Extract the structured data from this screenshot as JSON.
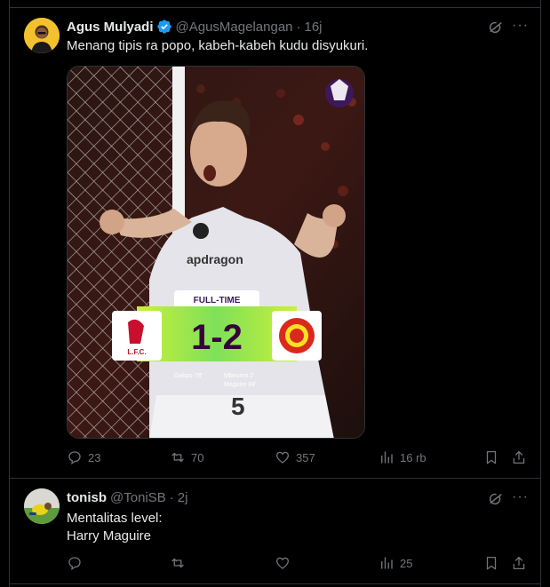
{
  "tweet1": {
    "name": "Agus Mulyadi",
    "handle": "@AgusMagelangan",
    "separator": "·",
    "time": "16j",
    "text": "Menang tipis ra popo, kabeh-kabeh kudu disyukuri.",
    "media": {
      "label": "FULL-TIME",
      "score": "1-2",
      "home_scorers": "Gakpo 78'",
      "away_scorers_1": "Mbeumo 2'",
      "away_scorers_2": "Maguire 84'",
      "shirt_sponsor": "apdragon",
      "shirt_number": "5",
      "home_crest_text": "L.F.C."
    },
    "counts": {
      "replies": "23",
      "reposts": "70",
      "likes": "357",
      "views": "16 rb"
    }
  },
  "tweet2": {
    "name": "tonisb",
    "handle": "@ToniSB",
    "separator": "·",
    "time": "2j",
    "text_line1": "Mentalitas level:",
    "text_line2": "Harry Maguire",
    "counts": {
      "views": "25"
    }
  },
  "colors": {
    "accent": "#1d9bf0",
    "muted": "#71767b",
    "text": "#e7e9ea",
    "border": "#2f3336",
    "pitch_green": "#a8e63a"
  }
}
